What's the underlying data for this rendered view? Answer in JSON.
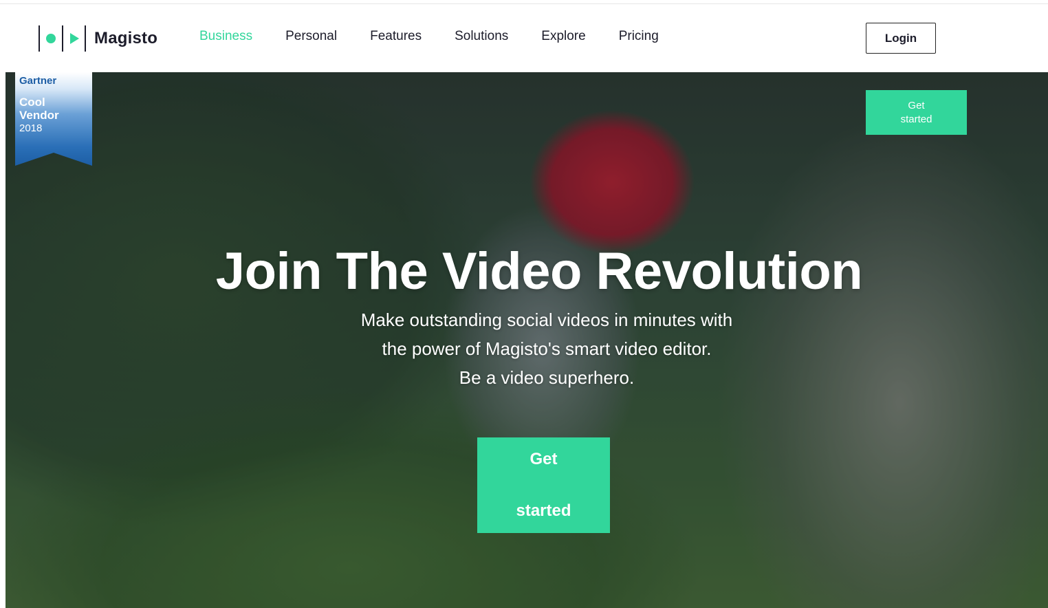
{
  "brand": {
    "name": "Magisto",
    "accent_color": "#32d69b"
  },
  "nav": {
    "items": [
      {
        "label": "Business",
        "active": true
      },
      {
        "label": "Personal",
        "active": false
      },
      {
        "label": "Features",
        "active": false
      },
      {
        "label": "Solutions",
        "active": false
      },
      {
        "label": "Explore",
        "active": false
      },
      {
        "label": "Pricing",
        "active": false
      }
    ],
    "login_label": "Login"
  },
  "badge": {
    "line1": "Gartner",
    "line2": "Cool Vendor",
    "line3": "2018"
  },
  "hero": {
    "small_cta_label": "Get started",
    "headline": "Join The Video Revolution",
    "subtext_line1": "Make outstanding social videos in minutes with",
    "subtext_line2": "the power of Magisto's smart video editor.",
    "subtext_line3": "Be a video superhero.",
    "cta_line1": "Get",
    "cta_line2": "started"
  }
}
